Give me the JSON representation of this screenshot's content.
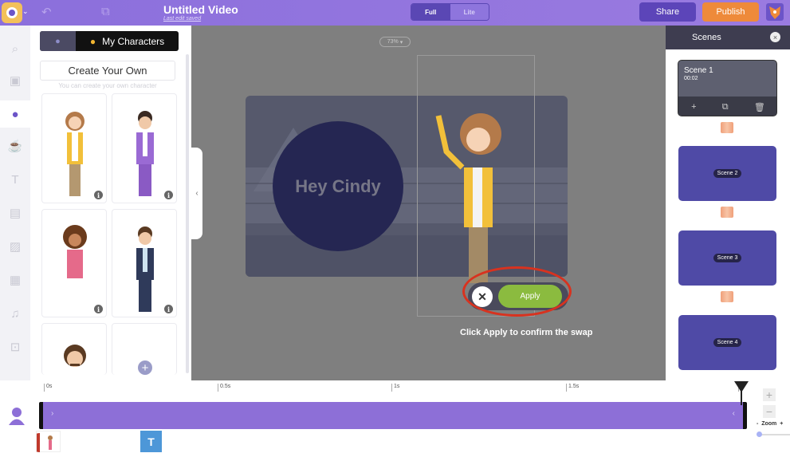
{
  "header": {
    "title": "Untitled Video",
    "subtitle": "Last edit saved",
    "mode_options": [
      "Full",
      "Lite"
    ],
    "mode_selected": "Full",
    "share_label": "Share",
    "publish_label": "Publish"
  },
  "colors": {
    "brand": "#8b6fdc",
    "publish": "#ee8a3a",
    "apply": "#8bbb3f",
    "highlight_ring": "#d8321f",
    "track": "#8d6fd7"
  },
  "sidebar": {
    "icons": [
      "search-icon",
      "scene-icon",
      "character-icon",
      "props-icon",
      "text-icon",
      "background-icon",
      "image-icon",
      "video-icon",
      "music-icon",
      "upload-icon"
    ]
  },
  "characters_panel": {
    "tab_label": "My Characters",
    "create_label": "Create Your Own",
    "create_hint": "You can create your own character",
    "info_glyph": "i",
    "add_glyph": "+"
  },
  "canvas": {
    "zoom": "73%",
    "bubble_text": "Hey Cindy",
    "apply_label": "Apply",
    "cancel_glyph": "✕",
    "hint": "Click Apply to confirm the swap"
  },
  "scenes": {
    "title": "Scenes",
    "close_glyph": "×",
    "items": [
      {
        "label": "Scene 1",
        "duration": "00:02"
      },
      {
        "label": "Scene 2"
      },
      {
        "label": "Scene 3"
      },
      {
        "label": "Scene 4"
      }
    ]
  },
  "timeline": {
    "ticks": [
      "0s",
      "0.5s",
      "1s",
      "1.5s",
      "2"
    ],
    "zoom_label": "Zoom",
    "zoom_minus": "-",
    "zoom_plus": "+",
    "text_item": "T"
  }
}
